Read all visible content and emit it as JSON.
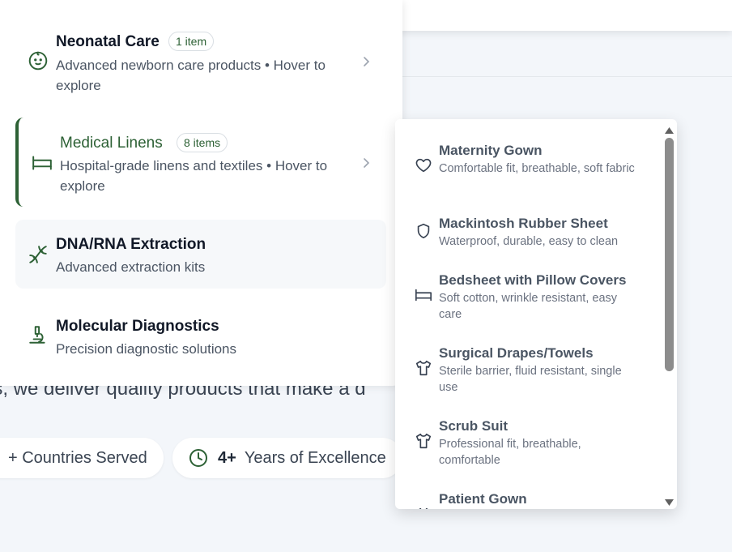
{
  "hero": {
    "text": "ics, we deliver quality products that make a d",
    "stats": [
      {
        "number": "",
        "label": "+ Countries Served"
      },
      {
        "number": "4+",
        "label": "Years of Excellence"
      }
    ]
  },
  "menu": {
    "categories": [
      {
        "title": "Neonatal Care",
        "badge": "1 item",
        "description": "Advanced newborn care products • Hover to explore",
        "icon": "baby-face-icon"
      },
      {
        "title": "Medical Linens",
        "badge": "8 items",
        "description": "Hospital-grade linens and textiles • Hover to explore",
        "icon": "bed-icon"
      },
      {
        "title": "DNA/RNA Extraction",
        "description": "Advanced extraction kits",
        "icon": "dna-icon"
      },
      {
        "title": "Molecular Diagnostics",
        "description": "Precision diagnostic solutions",
        "icon": "microscope-icon"
      }
    ]
  },
  "submenu": {
    "items": [
      {
        "title": "Maternity Gown",
        "description": "Comfortable fit, breathable, soft fabric",
        "icon": "heart-icon"
      },
      {
        "title": "Mackintosh Rubber Sheet",
        "description": "Waterproof, durable, easy to clean",
        "icon": "shield-icon"
      },
      {
        "title": "Bedsheet with Pillow Covers",
        "description": "Soft cotton, wrinkle resistant, easy care",
        "icon": "bed-icon"
      },
      {
        "title": "Surgical Drapes/Towels",
        "description": "Sterile barrier, fluid resistant, single use",
        "icon": "shirt-icon"
      },
      {
        "title": "Scrub Suit",
        "description": "Professional fit, breathable, comfortable",
        "icon": "shirt-icon"
      },
      {
        "title": "Patient Gown",
        "description": "",
        "icon": "shirt-icon"
      }
    ]
  },
  "colors": {
    "accent": "#2d6135",
    "background": "#f3f6fa"
  }
}
